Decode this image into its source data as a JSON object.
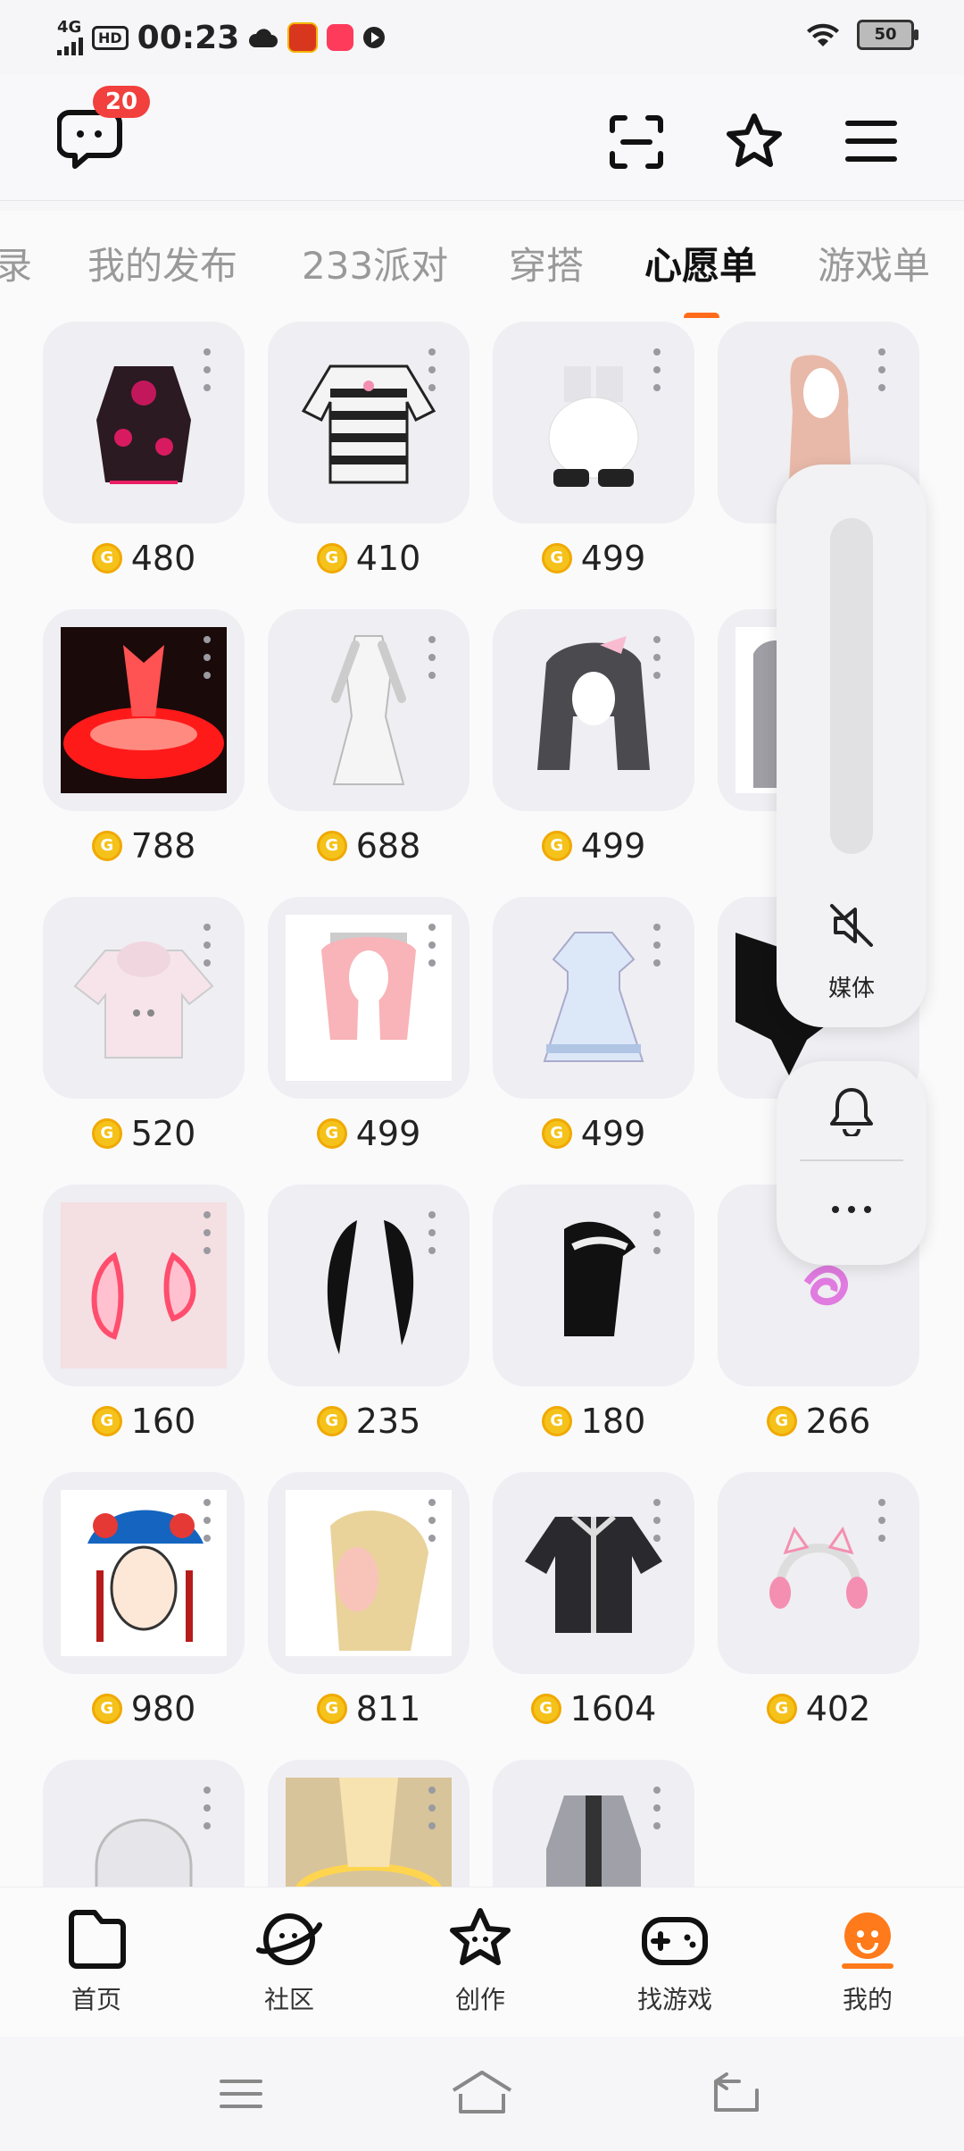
{
  "status_bar": {
    "network": "4G",
    "hd": "HD",
    "time": "00:23",
    "battery": "50"
  },
  "header": {
    "message_badge": "20"
  },
  "tabs": [
    "录",
    "我的发布",
    "233派对",
    "穿搭",
    "心愿单",
    "游戏单"
  ],
  "active_tab": "心愿单",
  "items": [
    {
      "price": "480"
    },
    {
      "price": "410"
    },
    {
      "price": "499"
    },
    {
      "price": ""
    },
    {
      "price": "788"
    },
    {
      "price": "688"
    },
    {
      "price": "499"
    },
    {
      "price": ""
    },
    {
      "price": "520"
    },
    {
      "price": "499"
    },
    {
      "price": "499"
    },
    {
      "price": ""
    },
    {
      "price": "160"
    },
    {
      "price": "235"
    },
    {
      "price": "180"
    },
    {
      "price": "266"
    },
    {
      "price": "980"
    },
    {
      "price": "811"
    },
    {
      "price": "1604"
    },
    {
      "price": "402"
    },
    {
      "price": ""
    },
    {
      "price": ""
    },
    {
      "price": ""
    }
  ],
  "volume_panel": {
    "media_label": "媒体"
  },
  "bottom_nav": [
    {
      "label": "首页"
    },
    {
      "label": "社区"
    },
    {
      "label": "创作"
    },
    {
      "label": "找游戏"
    },
    {
      "label": "我的"
    }
  ],
  "colors": {
    "accent": "#ff6b1a",
    "badge": "#f1403d",
    "coin": "#f5c21b"
  }
}
